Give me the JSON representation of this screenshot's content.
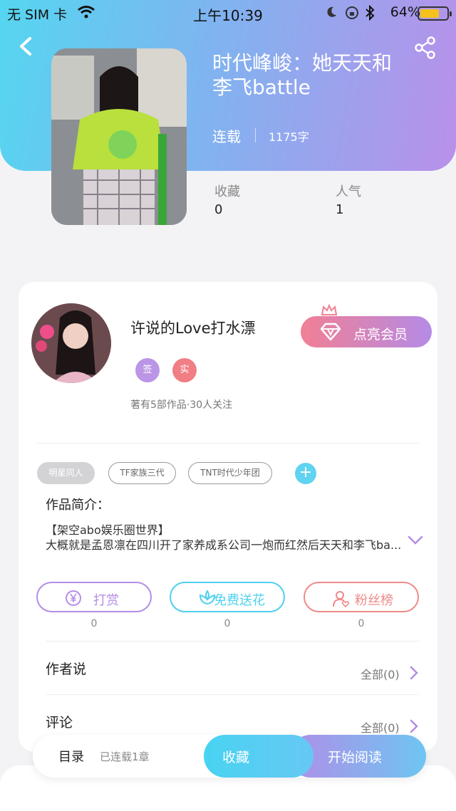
{
  "status_bar": {
    "carrier": "无 SIM 卡",
    "time": "上午10:39",
    "battery": "64%"
  },
  "book": {
    "title_line1": "时代峰峻：她天天和",
    "title_line2": "李飞battle",
    "status": "连载",
    "word_count": "1175字",
    "favorites_label": "收藏",
    "favorites_value": "0",
    "popularity_label": "人气",
    "popularity_value": "1"
  },
  "author": {
    "name": "许说的Love打水漂",
    "vip_button": "点亮会员",
    "badges": [
      "签",
      "实"
    ],
    "works_info": "著有5部作品·30人关注"
  },
  "tags": [
    "明星同人",
    "TF家族三代",
    "TNT时代少年团"
  ],
  "intro": {
    "label": "作品简介：",
    "line1": "【架空abo娱乐圈世界】",
    "line2": "大概就是孟恩凛在四川开了家养成系公司一炮而红然后天天和李飞battle"
  },
  "actions": [
    {
      "label": "打赏",
      "count": "0",
      "color": "#b48de6"
    },
    {
      "label": "免费送花",
      "count": "0",
      "color": "#4fd0ee"
    },
    {
      "label": "粉丝榜",
      "count": "0",
      "color": "#ef8a8a"
    }
  ],
  "sections": {
    "author_says": {
      "label": "作者说",
      "more": "全部(0)"
    },
    "comments": {
      "label": "评论",
      "more": "全部(0)"
    }
  },
  "bottom_bar": {
    "toc": "目录",
    "chapters": "已连载1章",
    "favorite": "收藏",
    "read": "开始阅读"
  },
  "icons": [
    "back-icon",
    "share-icon",
    "wifi-icon",
    "moon-icon",
    "bluetooth-icon",
    "crown-icon",
    "diamond-icon",
    "yen-icon",
    "flower-icon",
    "user-heart-icon",
    "chevron-down-icon",
    "chevron-right-icon"
  ]
}
